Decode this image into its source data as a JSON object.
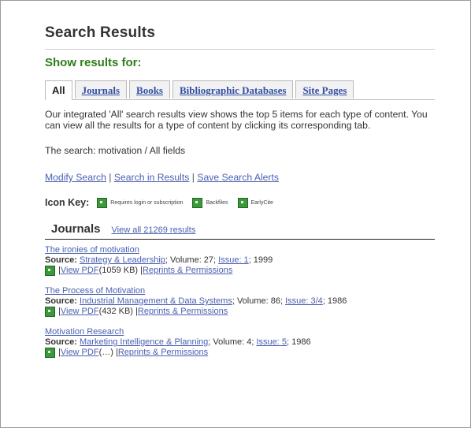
{
  "header": {
    "title": "Search Results",
    "show_results_for": "Show results for:"
  },
  "tabs": [
    {
      "label": "All",
      "active": true
    },
    {
      "label": "Journals",
      "active": false
    },
    {
      "label": "Books",
      "active": false
    },
    {
      "label": "Bibliographic Databases",
      "active": false
    },
    {
      "label": "Site Pages",
      "active": false
    }
  ],
  "description": "Our integrated 'All' search results view shows the top 5 items for each type of content. You can view all the results for a type of content by clicking its corresponding tab.",
  "search_line": "The search: motivation / All fields",
  "actions": {
    "modify": "Modify Search",
    "sep1": " | ",
    "search_in": "Search in Results",
    "sep2": " | ",
    "save_alerts": "Save Search Alerts"
  },
  "icon_key": {
    "label": "Icon Key:",
    "items": [
      {
        "icon": "green-square-icon",
        "text": "Requires login or subscription"
      },
      {
        "icon": "green-square-icon",
        "text": "Backfiles"
      },
      {
        "icon": "green-square-icon",
        "text": "EarlyCite"
      }
    ]
  },
  "journals": {
    "title": "Journals",
    "view_all": "View all 21269 results",
    "results": [
      {
        "title": "The ironies of motivation",
        "source_label": "Source:",
        "source": "Strategy & Leadership",
        "volume": "; Volume: 27; ",
        "issue": "Issue: 1",
        "year": "; 1999",
        "sep": " | ",
        "pdf": "View PDF",
        "size": " (1059 KB) | ",
        "perms": "Reprints & Permissions"
      },
      {
        "title": "The Process of Motivation",
        "source_label": "Source:",
        "source": "Industrial Management & Data Systems",
        "volume": "; Volume: 86; ",
        "issue": "Issue: 3/4",
        "year": "; 1986",
        "sep": " | ",
        "pdf": "View PDF",
        "size": " (432 KB) | ",
        "perms": "Reprints & Permissions"
      },
      {
        "title": "Motivation Research",
        "source_label": "Source:",
        "source": "Marketing Intelligence & Planning",
        "volume": "; Volume: 4; ",
        "issue": "Issue: 5",
        "year": "; 1986",
        "sep": " | ",
        "pdf": "View PDF",
        "size": " (…) | ",
        "perms": "Reprints & Permissions"
      }
    ]
  },
  "colors": {
    "accent_green": "#2e7d1a",
    "link": "#4a5fb0",
    "badge": "#3a9a3a"
  }
}
